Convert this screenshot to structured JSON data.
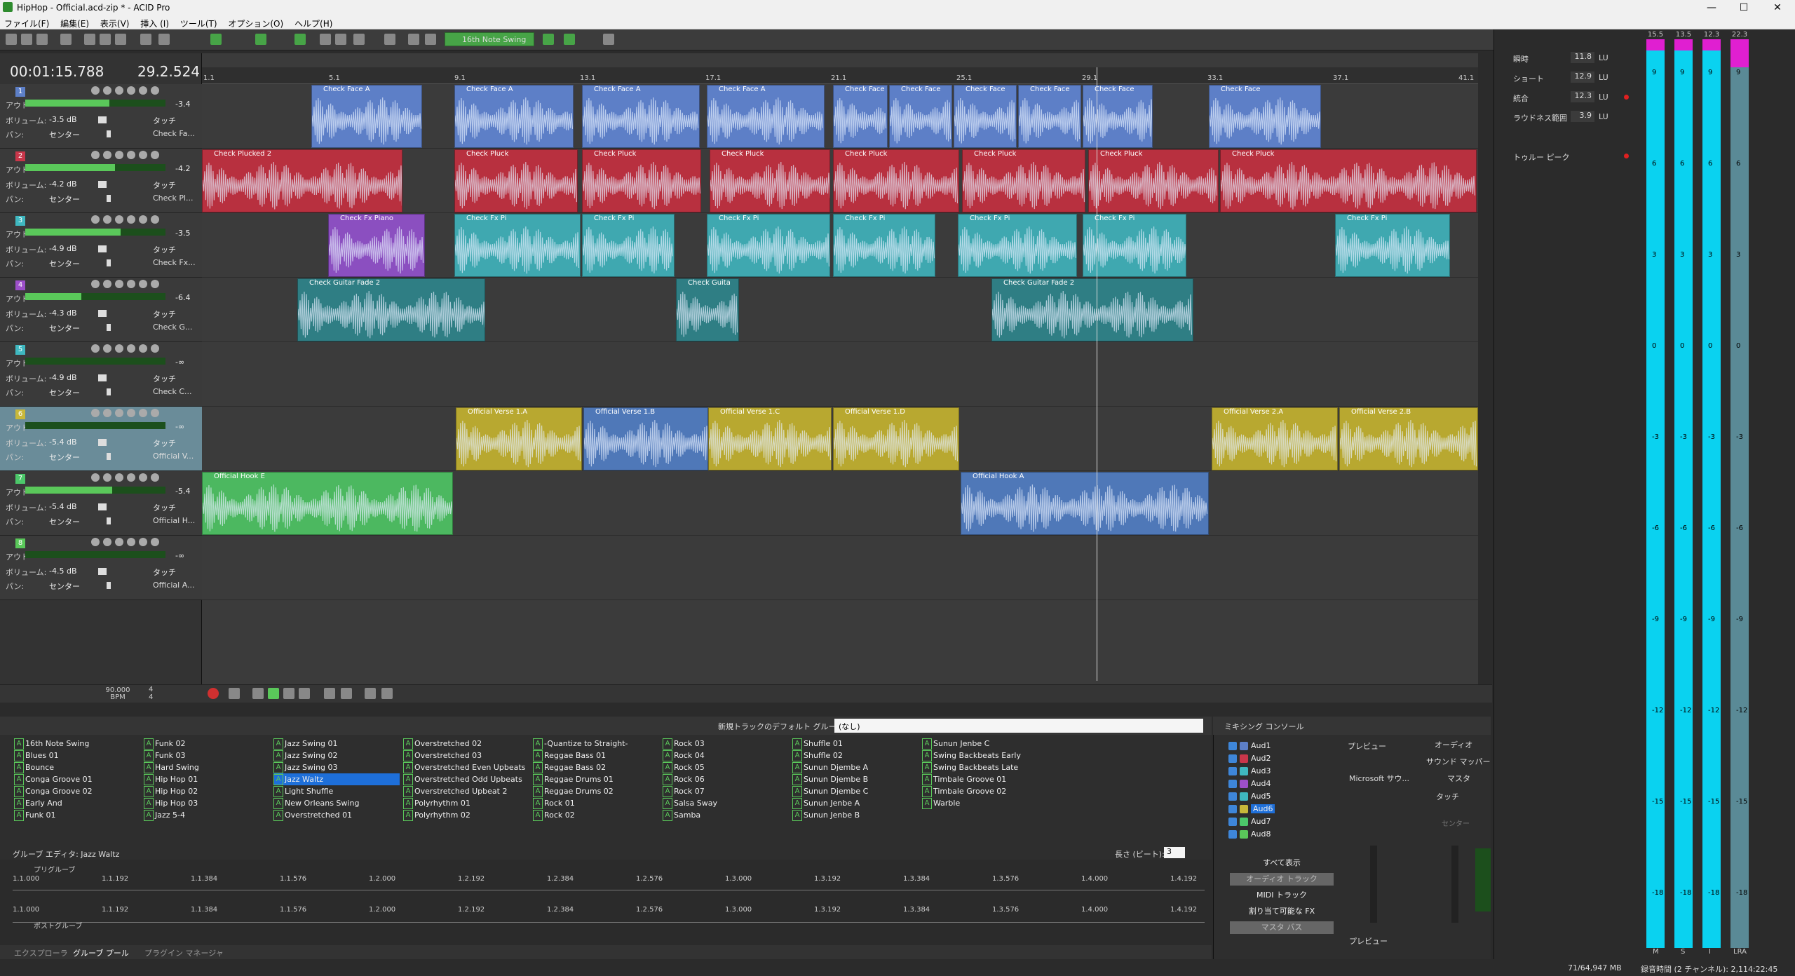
{
  "window": {
    "title": "HipHop - Official.acd-zip * - ACID Pro",
    "minimize": "—",
    "maximize": "☐",
    "close": "✕"
  },
  "menu": [
    "ファイル(F)",
    "編集(E)",
    "表示(V)",
    "挿入 (I)",
    "ツール(T)",
    "オプション(O)",
    "ヘルプ(H)"
  ],
  "toolbar": {
    "groove_select": "16th Note Swing"
  },
  "time": {
    "position": "00:01:15.788",
    "measure": "29.2.524"
  },
  "ruler_marks": [
    "1.1",
    "5.1",
    "9.1",
    "13.1",
    "17.1",
    "21.1",
    "25.1",
    "29.1",
    "33.1",
    "37.1",
    "41.1"
  ],
  "tracks": [
    {
      "num": "1",
      "color": "#5d7fc7",
      "level": "-3.4",
      "volume": "-3.5 dB",
      "pan": "センター",
      "name": "Check Fa...",
      "meter": 0.6
    },
    {
      "num": "2",
      "color": "#c9364a",
      "level": "-4.2",
      "volume": "-4.2 dB",
      "pan": "センター",
      "name": "Check Pl...",
      "meter": 0.64
    },
    {
      "num": "3",
      "color": "#3fb8c0",
      "level": "-3.5",
      "volume": "-4.9 dB",
      "pan": "センター",
      "name": "Check Fx...",
      "meter": 0.68
    },
    {
      "num": "4",
      "color": "#9c4fc8",
      "level": "-6.4",
      "volume": "-4.3 dB",
      "pan": "センター",
      "name": "Check G...",
      "meter": 0.4
    },
    {
      "num": "5",
      "color": "#3fb8c0",
      "level": "-∞",
      "volume": "-4.9 dB",
      "pan": "センター",
      "name": "Check C...",
      "meter": 0.0
    },
    {
      "num": "6",
      "color": "#c8b83a",
      "level": "-∞",
      "volume": "-5.4 dB",
      "pan": "センター",
      "name": "Official V...",
      "meter": 0.0
    },
    {
      "num": "7",
      "color": "#4cc86a",
      "level": "-5.4",
      "volume": "-5.4 dB",
      "pan": "センター",
      "name": "Official H...",
      "meter": 0.62
    },
    {
      "num": "8",
      "color": "#5ac85a",
      "level": "-∞",
      "volume": "-4.5 dB",
      "pan": "センター",
      "name": "Official A...",
      "meter": 0.0
    }
  ],
  "track_labels": {
    "out": "アウト",
    "volume": "ボリューム:",
    "pan": "パン:",
    "touch": "タッチ"
  },
  "clips": {
    "t1": [
      "Check Face A",
      "Check Face A",
      "Check Face A",
      "Check Face A",
      "Check Face",
      "Check Face",
      "Check Face",
      "Check Face",
      "Check Face",
      "Check Face"
    ],
    "t2": [
      "Check Plucked 2",
      "Check Pluck",
      "Check Pluck",
      "Check Pluck",
      "Check Pluck",
      "Check Pluck",
      "Check Pluck",
      "Check Pluck"
    ],
    "t3": [
      "Check Fx Piano",
      "Check Fx Pi",
      "Check Fx Pi",
      "Check Fx Pi",
      "Check Fx Pi",
      "Check Fx Pi",
      "Check Fx Pi",
      "Check Fx Pi"
    ],
    "t4": [
      "Check Guitar Fade 2",
      "Check Guita",
      "Check Guitar Fade 2"
    ],
    "t6": [
      "Official Verse 1.A",
      "Official Verse 1.B",
      "Official Verse 1.C",
      "Official Verse 1.D",
      "Official Verse 2.A",
      "Official Verse 2.B"
    ],
    "t7": [
      "Official Hook E",
      "Official Hook A"
    ]
  },
  "transport": {
    "bpm_value": "90.000",
    "bpm_label": "BPM",
    "sig_top": "4",
    "sig_bottom": "4"
  },
  "pool": {
    "default_group_label": "新規トラックのデフォルト グループ:",
    "default_group_value": "(なし)",
    "columns": [
      [
        "16th Note Swing",
        "Blues 01",
        "Bounce",
        "Conga Groove 01",
        "Conga Groove 02",
        "Early And",
        "Funk 01"
      ],
      [
        "Funk 02",
        "Funk 03",
        "Hard Swing",
        "Hip Hop 01",
        "Hip Hop 02",
        "Hip Hop 03",
        "Jazz 5-4"
      ],
      [
        "Jazz Swing 01",
        "Jazz Swing 02",
        "Jazz Swing 03",
        "Jazz Waltz",
        "Light Shuffle",
        "New Orleans Swing",
        "Overstretched 01"
      ],
      [
        "Overstretched 02",
        "Overstretched 03",
        "Overstretched Even Upbeats",
        "Overstretched Odd Upbeats",
        "Overstretched Upbeat 2",
        "Polyrhythm 01",
        "Polyrhythm 02"
      ],
      [
        "-Quantize to Straight-",
        "Reggae Bass 01",
        "Reggae Bass 02",
        "Reggae Drums 01",
        "Reggae Drums 02",
        "Rock 01",
        "Rock 02"
      ],
      [
        "Rock 03",
        "Rock 04",
        "Rock 05",
        "Rock 06",
        "Rock 07",
        "Salsa Sway",
        "Samba"
      ],
      [
        "Shuffle 01",
        "Shuffle 02",
        "Sunun Djembe A",
        "Sunun Djembe B",
        "Sunun Djembe C",
        "Sunun Jenbe A",
        "Sunun Jenbe B"
      ],
      [
        "Sunun Jenbe C",
        "Swing Backbeats Early",
        "Swing Backbeats Late",
        "Timbale Groove 01",
        "Timbale Groove 02",
        "Warble"
      ]
    ],
    "selected": "Jazz Waltz"
  },
  "groove_editor": {
    "label": "グルーブ エディタ: ",
    "name": "Jazz Waltz",
    "length_label": "長さ (ビート):",
    "length_value": "3",
    "pre": "プリグルーブ",
    "post": "ポストグルーブ",
    "ticks": [
      "1.1.000",
      "1.1.192",
      "1.1.384",
      "1.1.576",
      "1.2.000",
      "1.2.192",
      "1.2.384",
      "1.2.576",
      "1.3.000",
      "1.3.192",
      "1.3.384",
      "1.3.576",
      "1.4.000",
      "1.4.192"
    ]
  },
  "bottom_tabs": [
    "エクスプローラ",
    "グルーブ プール",
    "プラグイン マネージャ"
  ],
  "mixer": {
    "title": "ミキシング コンソール",
    "busses": [
      "Aud1",
      "Aud2",
      "Aud3",
      "Aud4",
      "Aud5",
      "Aud6",
      "Aud7",
      "Aud8"
    ],
    "selected": "Aud6",
    "buttons": [
      "すべて表示",
      "オーディオ トラック",
      "MIDI トラック",
      "割り当て可能な FX",
      "マスタ バス"
    ],
    "preview": "プレビュー",
    "device": "Microsoft サウ...",
    "audio": "オーディオ",
    "mapper": "サウンド マッパー",
    "master": "マスタ",
    "touch": "タッチ",
    "center": "センター",
    "preview2": "プレビュー"
  },
  "loudness": {
    "rows": [
      {
        "label": "瞬時",
        "value": "11.8",
        "unit": "LU",
        "dot": false
      },
      {
        "label": "ショート",
        "value": "12.9",
        "unit": "LU",
        "dot": false
      },
      {
        "label": "統合",
        "value": "12.3",
        "unit": "LU",
        "dot": true
      },
      {
        "label": "ラウドネス範囲",
        "value": "3.9",
        "unit": "LU",
        "dot": false
      }
    ],
    "true_peak": "トゥルー ピーク"
  },
  "meters": {
    "tops": [
      "15.5",
      "13.5",
      "12.3",
      "22.3"
    ],
    "labels": [
      "M",
      "S",
      "I",
      "LRA"
    ],
    "scale": [
      "9",
      "6",
      "3",
      "0",
      "-3",
      "-6",
      "-9",
      "-12",
      "-15",
      "-18"
    ]
  },
  "status": {
    "memory": "71/64,947 MB",
    "record": "録音時間 (2 チャンネル): 2,114:22:45"
  },
  "colors": {
    "accent": "#47a447",
    "selection": "#1e6fd9",
    "meter": "#0ad2f0",
    "peak": "#e01fd1"
  }
}
